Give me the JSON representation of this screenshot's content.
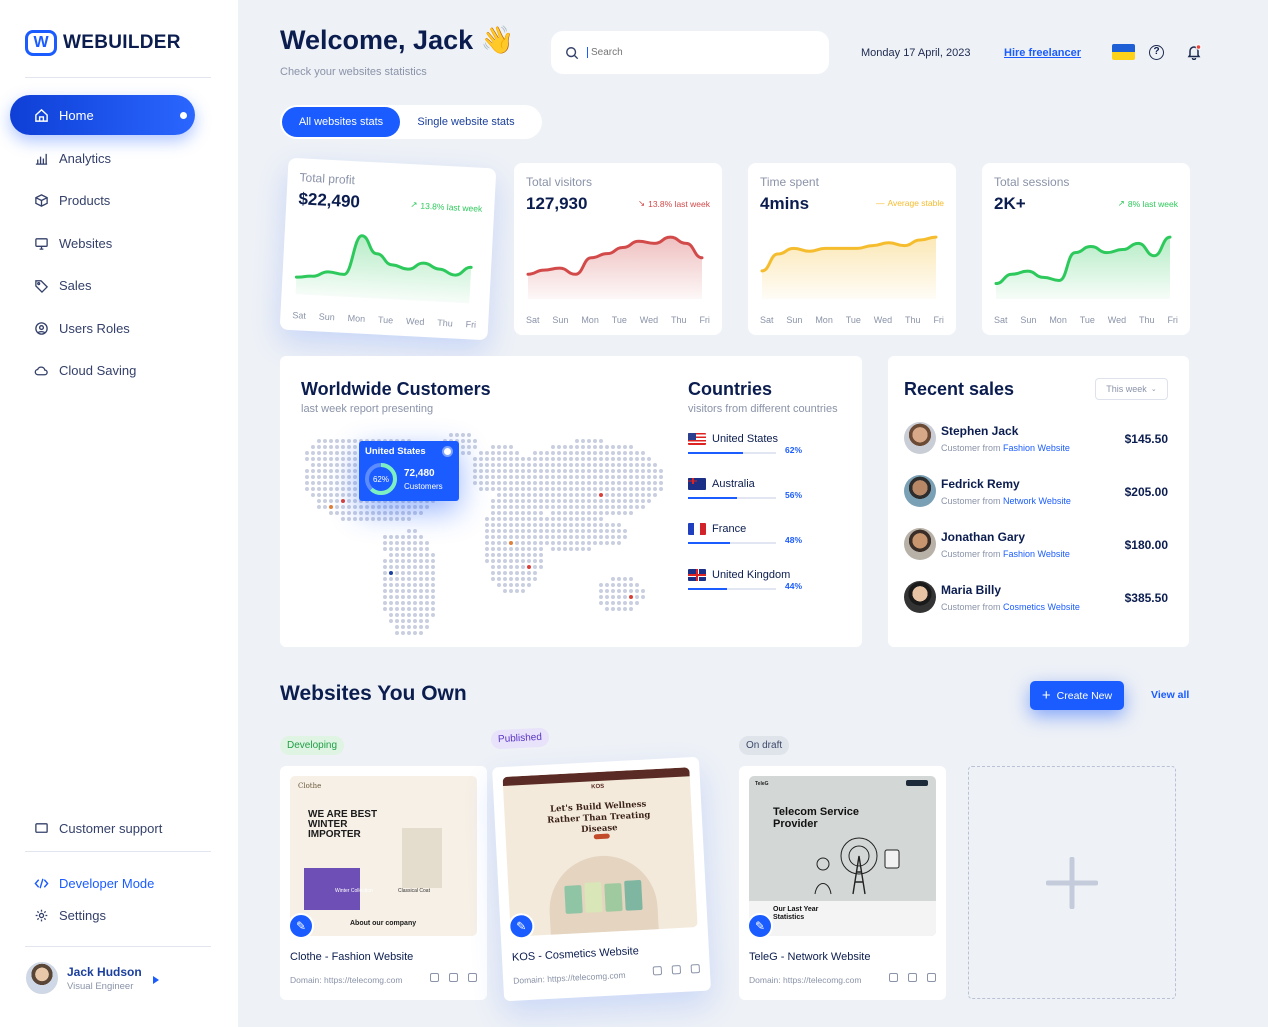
{
  "brand": {
    "name": "WEBUILDER"
  },
  "sidebar": {
    "items": [
      {
        "label": "Home",
        "icon": "home-icon"
      },
      {
        "label": "Analytics",
        "icon": "bar-chart-icon"
      },
      {
        "label": "Products",
        "icon": "box-icon"
      },
      {
        "label": "Websites",
        "icon": "monitor-icon"
      },
      {
        "label": "Sales",
        "icon": "tag-icon"
      },
      {
        "label": "Users Roles",
        "icon": "user-circle-icon"
      },
      {
        "label": "Cloud Saving",
        "icon": "cloud-icon"
      }
    ],
    "bottom": [
      {
        "label": "Customer support",
        "icon": "chat-icon"
      },
      {
        "label": "Developer Mode",
        "icon": "code-icon"
      },
      {
        "label": "Settings",
        "icon": "gear-icon"
      }
    ],
    "user": {
      "name": "Jack Hudson",
      "role": "Visual Engineer"
    }
  },
  "header": {
    "welcome": "Welcome, Jack",
    "wave": "👋",
    "subtitle": "Check your websites statistics",
    "search_placeholder": "Search",
    "date": "Monday 17 April, 2023",
    "hire": "Hire freelancer"
  },
  "tabs": {
    "all": "All websites stats",
    "single": "Single website stats"
  },
  "stats": [
    {
      "label": "Total profit",
      "value": "$22,490",
      "trend": "13.8% last week",
      "trend_dir": "up",
      "color": "#2ec95c",
      "series": [
        10,
        11,
        14,
        13,
        36,
        26,
        20,
        18,
        22,
        19,
        16,
        21
      ]
    },
    {
      "label": "Total visitors",
      "value": "127,930",
      "trend": "13.8% last week",
      "trend_dir": "down",
      "color": "#d24a4a",
      "series": [
        12,
        14,
        15,
        12,
        20,
        22,
        25,
        28,
        27,
        30,
        27,
        20
      ]
    },
    {
      "label": "Time spent",
      "value": "4mins",
      "trend": "Average stable",
      "trend_dir": "flat",
      "color": "#f5bd2e",
      "series": [
        10,
        16,
        18,
        17,
        18,
        18,
        18,
        19,
        20,
        19,
        21,
        22
      ]
    },
    {
      "label": "Total sessions",
      "value": "2K+",
      "trend": "8% last week",
      "trend_dir": "up",
      "color": "#2ec95c",
      "series": [
        10,
        16,
        18,
        14,
        12,
        30,
        34,
        30,
        32,
        36,
        28,
        40
      ]
    }
  ],
  "days": [
    "Sat",
    "Sun",
    "Mon",
    "Tue",
    "Wed",
    "Thu",
    "Fri"
  ],
  "customers": {
    "title": "Worldwide Customers",
    "subtitle": "last week report presenting",
    "tooltip": {
      "country": "United States",
      "pct": "62%",
      "value": "72,480",
      "label": "Customers"
    }
  },
  "countries": {
    "title": "Countries",
    "subtitle": "visitors from different countries",
    "list": [
      {
        "name": "United States",
        "pct": "62%",
        "value": 62,
        "flag": "us"
      },
      {
        "name": "Australia",
        "pct": "56%",
        "value": 56,
        "flag": "au"
      },
      {
        "name": "France",
        "pct": "48%",
        "value": 48,
        "flag": "fr"
      },
      {
        "name": "United Kingdom",
        "pct": "44%",
        "value": 44,
        "flag": "uk"
      }
    ]
  },
  "recent_sales": {
    "title": "Recent sales",
    "filter": "This week",
    "rows": [
      {
        "name": "Stephen Jack",
        "prefix": "Customer from",
        "site": "Fashion Website",
        "amount": "$145.50"
      },
      {
        "name": "Fedrick Remy",
        "prefix": "Customer from",
        "site": "Network Website",
        "amount": "$205.00"
      },
      {
        "name": "Jonathan Gary",
        "prefix": "Customer from",
        "site": "Fashion Website",
        "amount": "$180.00"
      },
      {
        "name": "Maria Billy",
        "prefix": "Customer from",
        "site": "Cosmetics Website",
        "amount": "$385.50"
      }
    ]
  },
  "websites": {
    "title": "Websites You Own",
    "create": "Create New",
    "view_all": "View all",
    "cards": [
      {
        "status": "Developing",
        "name": "Clothe - Fashion Website",
        "domain": "Domain: https://telecomg.com",
        "thumb_title": "WE ARE BEST WINTER IMPORTER",
        "thumb_sub": "About our company",
        "thumb_tag": "Winter Collection",
        "thumb_coat": "Classical Coat",
        "thumb_logo": "Clothe"
      },
      {
        "status": "Published",
        "name": "KOS - Cosmetics Website",
        "domain": "Domain: https://telecomg.com",
        "thumb_title": "Let's Build Wellness Rather Than Treating Disease",
        "thumb_logo": "KOS"
      },
      {
        "status": "On draft",
        "name": "TeleG - Network Website",
        "domain": "Domain: https://telecomg.com",
        "thumb_title": "Telecom Service Provider",
        "thumb_sub": "Our Last Year Statistics",
        "thumb_logo": "TeleG"
      }
    ]
  }
}
